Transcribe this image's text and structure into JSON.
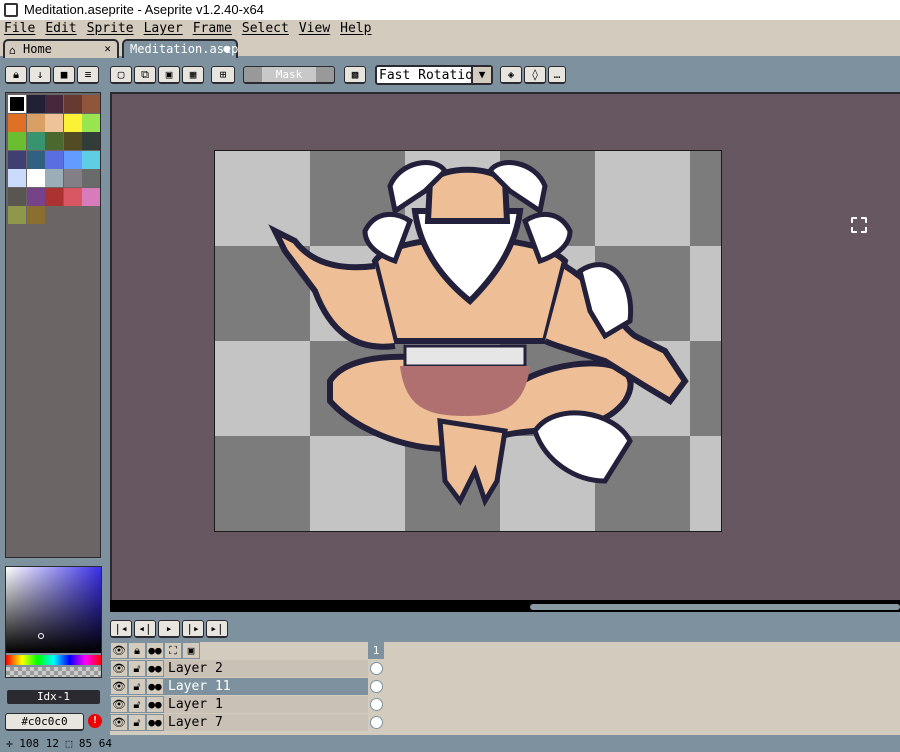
{
  "window": {
    "title": "Meditation.aseprite - Aseprite v1.2.40-x64"
  },
  "menu": [
    "File",
    "Edit",
    "Sprite",
    "Layer",
    "Frame",
    "Select",
    "View",
    "Help"
  ],
  "tabs": [
    {
      "label": "Home",
      "icon": "home-icon"
    },
    {
      "label": "Meditation.asep",
      "icon": "dot-icon"
    }
  ],
  "toolbar": {
    "mask_label": "Mask",
    "rotation": "Fast Rotation"
  },
  "palette": {
    "colors": [
      "#000000",
      "#222034",
      "#45283c",
      "#663931",
      "#8f563b",
      "#df7126",
      "#d9a066",
      "#eec39a",
      "#fbf236",
      "#99e550",
      "#6abe30",
      "#37946e",
      "#4b692f",
      "#524b24",
      "#323c39",
      "#3f3f74",
      "#306082",
      "#5b6ee1",
      "#639bff",
      "#5fcde4",
      "#cbdbfc",
      "#ffffff",
      "#9badb7",
      "#847e87",
      "#696a6a",
      "#595652",
      "#76428a",
      "#ac3232",
      "#d95763",
      "#d77bba",
      "#8f974a",
      "#8a6f30"
    ]
  },
  "color": {
    "index_label": "Idx-1",
    "hex_label": "#c0c0c0"
  },
  "layers": {
    "frame_number": "1",
    "rows": [
      {
        "name": "Layer 2",
        "selected": false
      },
      {
        "name": "Layer 11",
        "selected": true
      },
      {
        "name": "Layer 1",
        "selected": false
      },
      {
        "name": "Layer 7",
        "selected": false
      }
    ]
  },
  "status": {
    "x": "108",
    "y": "12",
    "w": "85",
    "h": "64"
  }
}
